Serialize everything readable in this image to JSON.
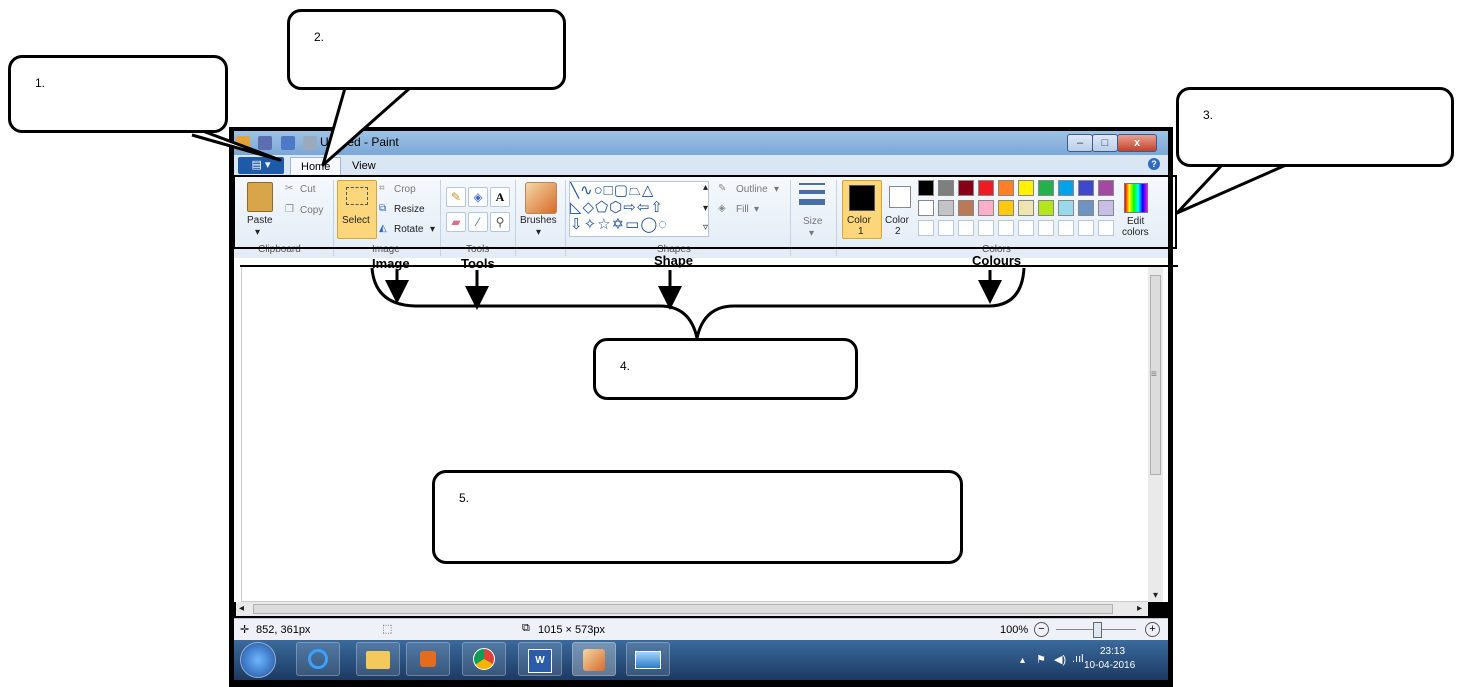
{
  "window": {
    "title": "Untitled - Paint"
  },
  "tabs": [
    "Home",
    "View"
  ],
  "ribbon": {
    "clipboard": {
      "paste": "Paste",
      "cut": "Cut",
      "copy": "Copy",
      "label": "Clipboard"
    },
    "image": {
      "select": "Select",
      "crop": "Crop",
      "resize": "Resize",
      "rotate": "Rotate",
      "label": "Image"
    },
    "tools": {
      "label": "Tools"
    },
    "brushes": {
      "label": "Brushes"
    },
    "shapes": {
      "outline": "Outline",
      "fill": "Fill",
      "label": "Shapes"
    },
    "size": {
      "label": "Size"
    },
    "colors": {
      "color1": "Color",
      "color1_num": "1",
      "color2": "Color",
      "color2_num": "2",
      "edit1": "Edit",
      "edit2": "colors",
      "label": "Colors",
      "palette_row1": [
        "#000000",
        "#7f7f7f",
        "#880015",
        "#ed1c24",
        "#ff7f27",
        "#fff200",
        "#22b14c",
        "#00a2e8",
        "#3f48cc",
        "#a349a4"
      ],
      "palette_row2": [
        "#ffffff",
        "#c3c3c3",
        "#b97a57",
        "#ffaec9",
        "#ffc90e",
        "#efe4b0",
        "#b5e61d",
        "#99d9ea",
        "#7092be",
        "#c8bfe7"
      ]
    }
  },
  "status": {
    "coords": "852, 361px",
    "size": "1015 × 573px",
    "zoom": "100%"
  },
  "clock": {
    "time": "23:13",
    "date": "10-04-2016"
  },
  "annotations": {
    "image": "Image",
    "tools": "Tools",
    "shape": "Shape",
    "colours": "Colours"
  },
  "callouts": {
    "c1": "1.",
    "c2": "2.",
    "c3": "3.",
    "c4": "4.",
    "c5": "5."
  }
}
